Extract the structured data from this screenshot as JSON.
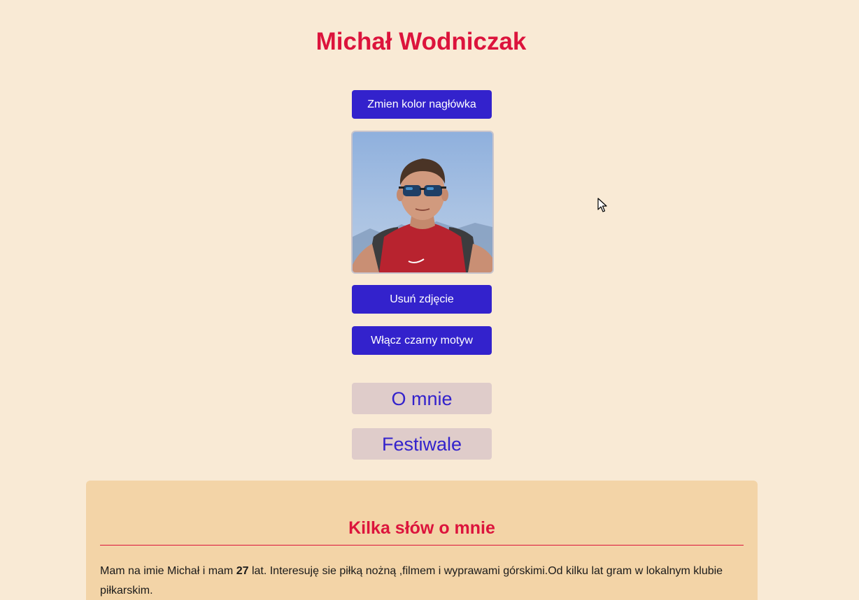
{
  "header": {
    "title": "Michał Wodniczak"
  },
  "buttons": {
    "change_header_color": "Zmien kolor nagłówka",
    "remove_photo": "Usuń zdjęcie",
    "dark_theme": "Włącz czarny motyw"
  },
  "photo": {
    "alt": "Zdjęcie profilowe"
  },
  "nav": {
    "about": "O mnie",
    "festivals": "Festiwale"
  },
  "about": {
    "heading": "Kilka słów o mnie",
    "text_before_age": "Mam na imie Michał i mam ",
    "age": "27",
    "text_after_age": " lat. Interesuję sie piłką nożną ,filmem i wyprawami górskimi.Od kilku lat gram w lokalnym klubie piłkarskim."
  },
  "colors": {
    "background": "#f9ead5",
    "accent_red": "#dc143c",
    "button_blue": "#3322cc",
    "tab_background": "#dfccca",
    "section_background": "#f3d4a7"
  }
}
